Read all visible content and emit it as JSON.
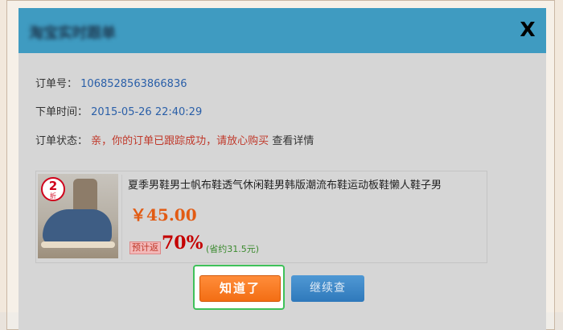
{
  "dialog": {
    "title": "淘宝实时跟单",
    "close_label": "X"
  },
  "order": {
    "number_label": "订单号：",
    "number_value": "1068528563866836",
    "time_label": "下单时间：",
    "time_value": "2015-05-26 22:40:29",
    "status_label": "订单状态：",
    "status_value": "亲，你的订单已跟踪成功，请放心购买",
    "details_link": "查看详情"
  },
  "product": {
    "title": "夏季男鞋男士帆布鞋透气休闲鞋男韩版潮流布鞋运动板鞋懒人鞋子男",
    "price": "￥45.00",
    "badge_number": "2",
    "badge_unit": "折",
    "rebate_label": "预计返",
    "rebate_rate": "70%",
    "savings": "(省约31.5元)"
  },
  "buttons": {
    "ok_label": "知道了",
    "continue_label": "继续查"
  },
  "colors": {
    "header": "#3f9bc1",
    "ok_button": "#f36e14",
    "continue_button": "#2f79bb",
    "focus_ring": "#3fc15a"
  }
}
